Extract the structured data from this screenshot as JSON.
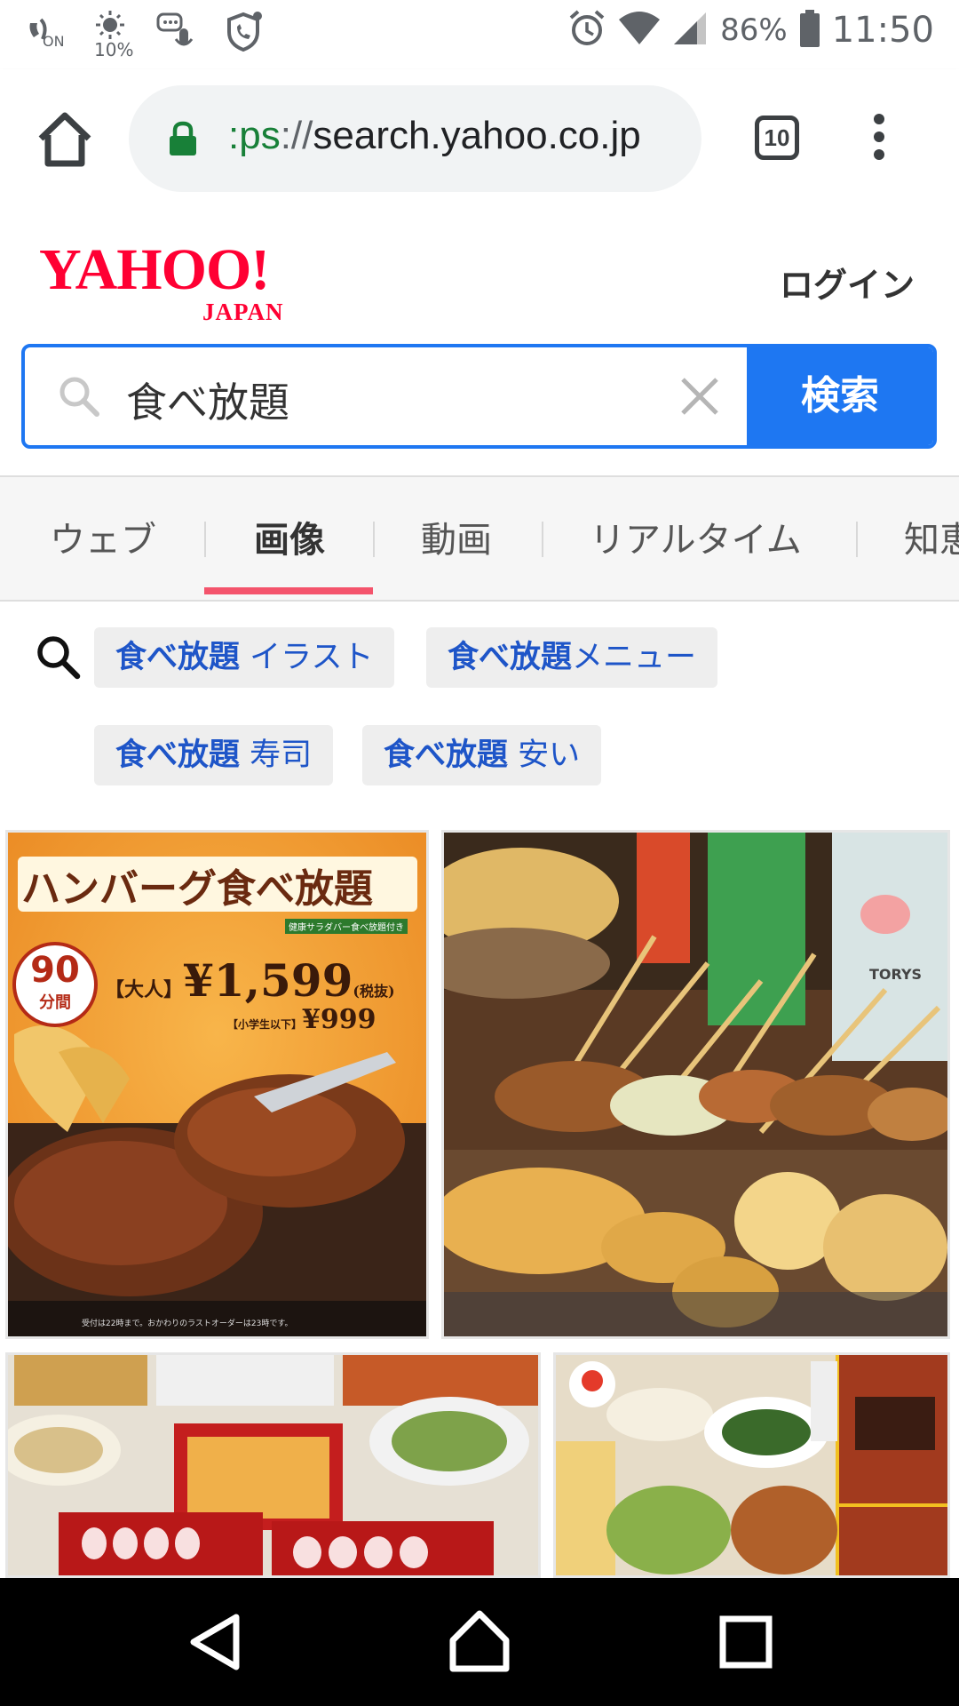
{
  "status_bar": {
    "left_icons": [
      "nfc-on-icon",
      "brightness-icon",
      "voice-message-icon",
      "security-call-icon"
    ],
    "brightness_label": "10%",
    "nfc_label": "ON",
    "battery": "86%",
    "time": "11:50"
  },
  "browser": {
    "url_scheme": ":ps",
    "url_sep": "://",
    "url_host": "search.yahoo.co.jp",
    "tab_count": "10"
  },
  "header": {
    "logo_main": "YAHOO!",
    "logo_sub": "JAPAN",
    "login": "ログイン"
  },
  "search": {
    "query": "食べ放題",
    "button": "検索"
  },
  "tabs": [
    {
      "label": "ウェブ",
      "active": false
    },
    {
      "label": "画像",
      "active": true
    },
    {
      "label": "動画",
      "active": false
    },
    {
      "label": "リアルタイム",
      "active": false
    },
    {
      "label": "知恵",
      "active": false
    }
  ],
  "related": [
    {
      "bold": "食べ放題",
      "rest": " イラスト"
    },
    {
      "bold": "食べ放題",
      "rest": "メニュー"
    },
    {
      "bold": "食べ放題",
      "rest": " 寿司"
    },
    {
      "bold": "食べ放題",
      "rest": " 安い"
    }
  ],
  "images": {
    "tile1": {
      "title": "ハンバーグ食べ放題",
      "minutes": "90",
      "minutes_unit": "分間",
      "adult_label": "【大人】",
      "adult_price": "¥1,599",
      "tax_label": "(税抜)",
      "child_label": "【小学生以下】",
      "child_price": "¥999",
      "salad_note": "健康サラダバー食べ放題付き",
      "footer_note": "受付は22時まで。おかわりのラストオーダーは23時です。"
    },
    "tile2": {
      "caption": "TORYS"
    }
  },
  "colors": {
    "yahoo_red": "#ff0033",
    "search_blue": "#1e77f2",
    "tab_underline": "#f4546c",
    "link_blue": "#1e55c8"
  }
}
